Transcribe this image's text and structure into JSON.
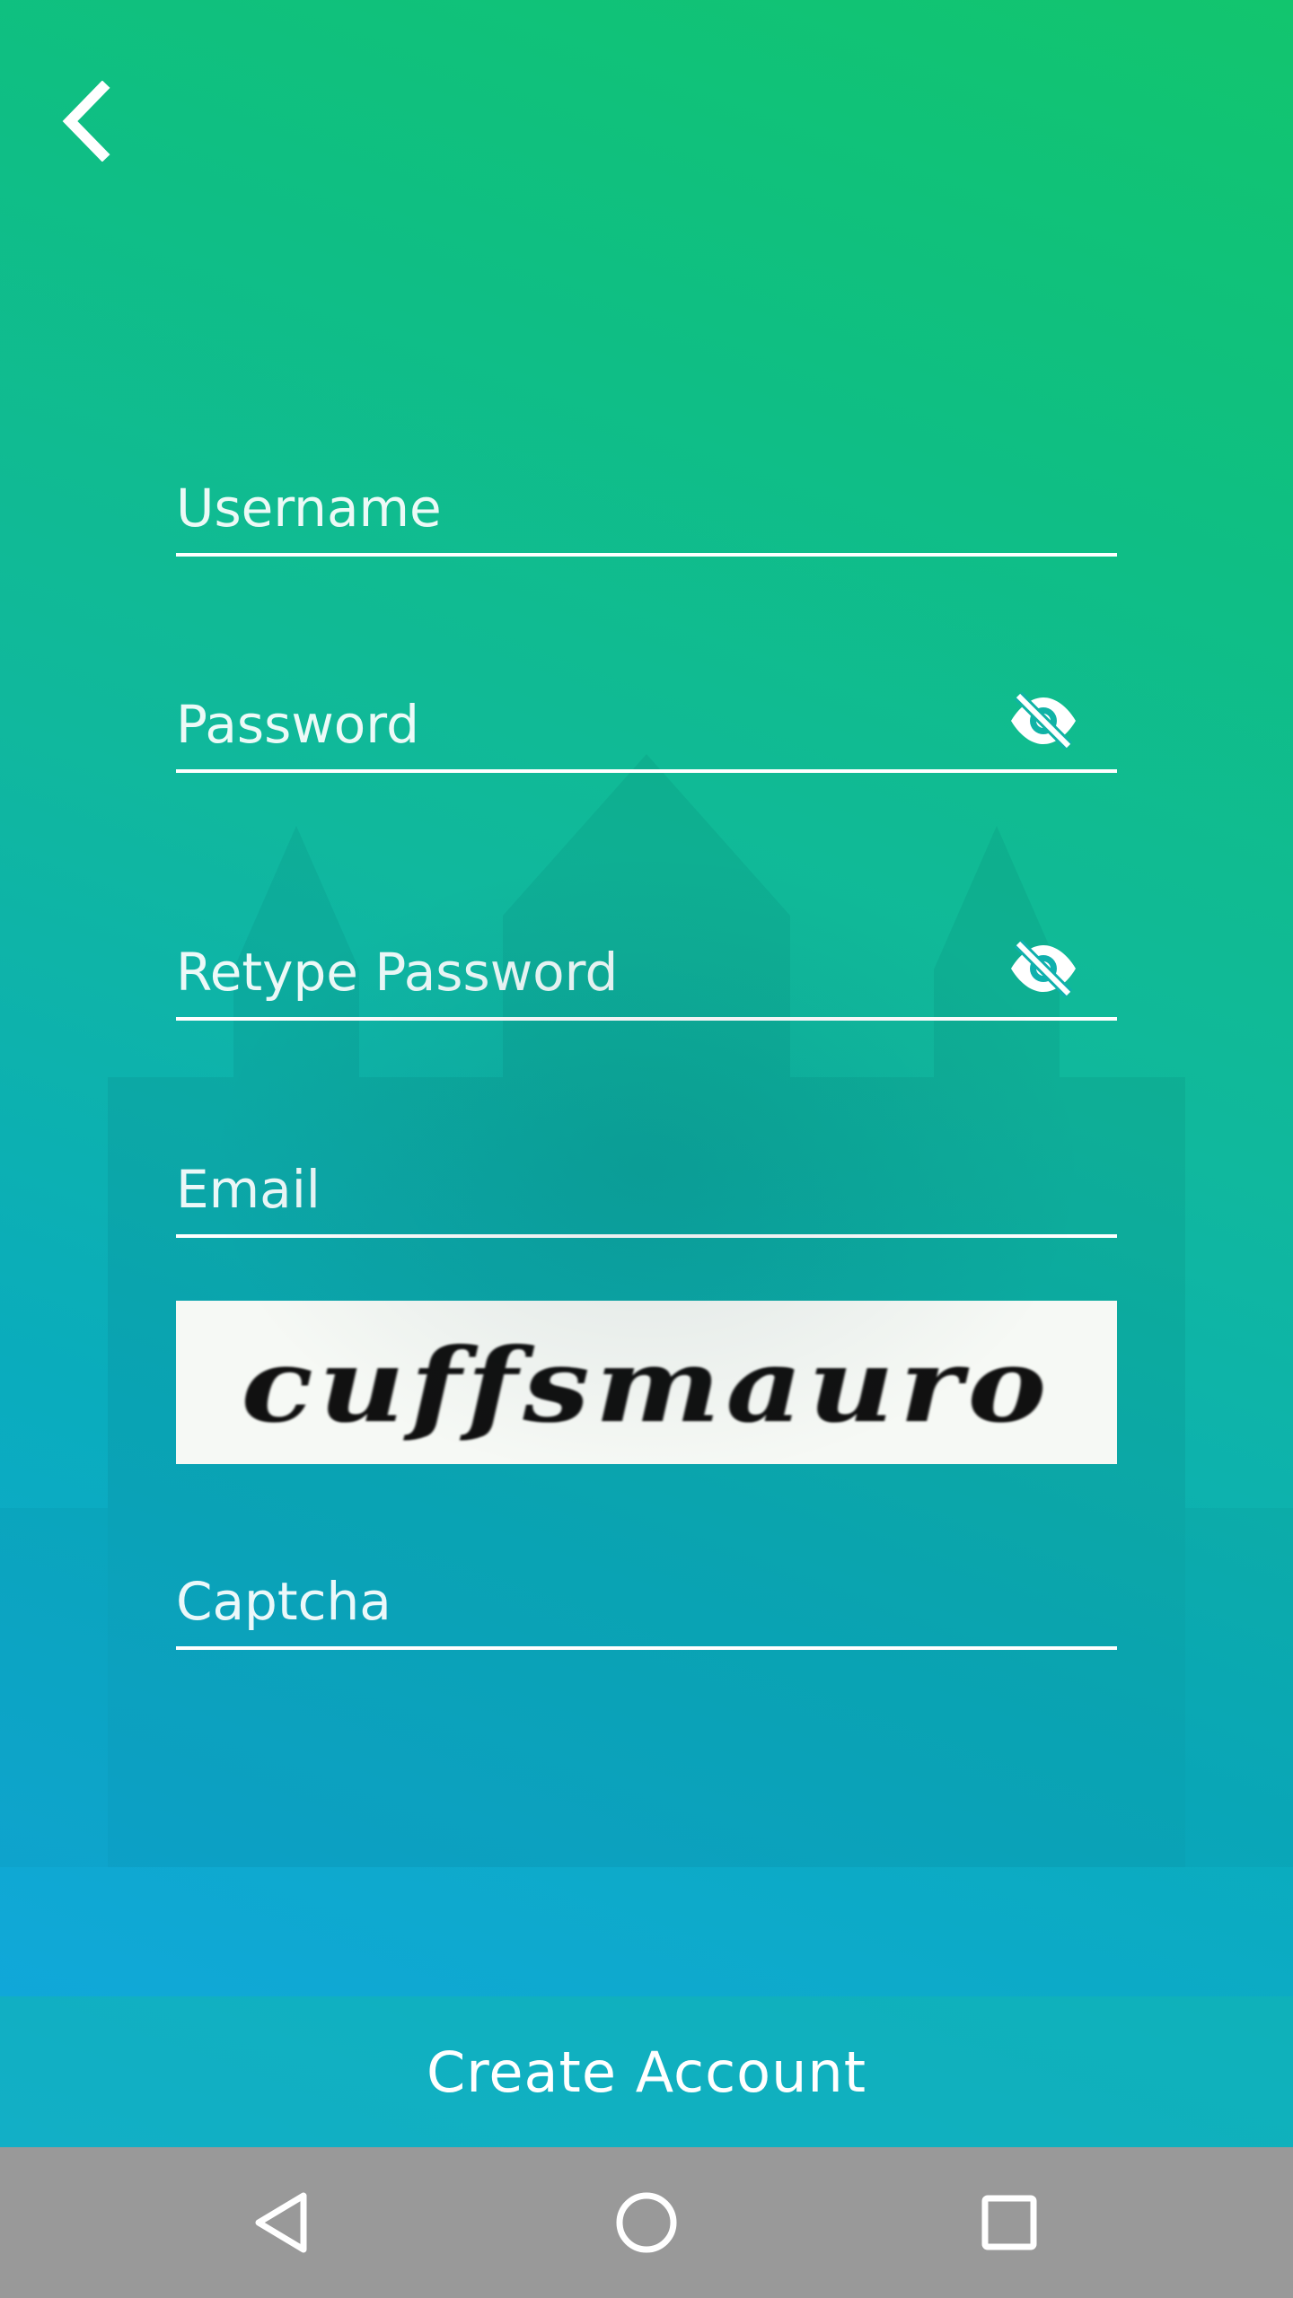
{
  "form": {
    "username": {
      "placeholder": "Username",
      "value": ""
    },
    "password": {
      "placeholder": "Password",
      "value": "",
      "toggle_icon": "eye-off-icon"
    },
    "retype_password": {
      "placeholder": "Retype Password",
      "value": "",
      "toggle_icon": "eye-off-icon"
    },
    "email": {
      "placeholder": "Email",
      "value": ""
    },
    "captcha_image_text": "cuffsmauro",
    "captcha": {
      "placeholder": "Captcha",
      "value": ""
    }
  },
  "actions": {
    "create_account_label": "Create Account"
  },
  "header": {
    "back_icon": "chevron-left-icon"
  },
  "system_nav": {
    "back_icon": "triangle-back-icon",
    "home_icon": "circle-home-icon",
    "recents_icon": "square-recents-icon"
  },
  "colors": {
    "gradient_top": "#12c56e",
    "gradient_bottom": "#12a6e0",
    "text": "#ffffff",
    "nav_bar": "#999999",
    "captcha_bg": "#f6f9f5"
  }
}
